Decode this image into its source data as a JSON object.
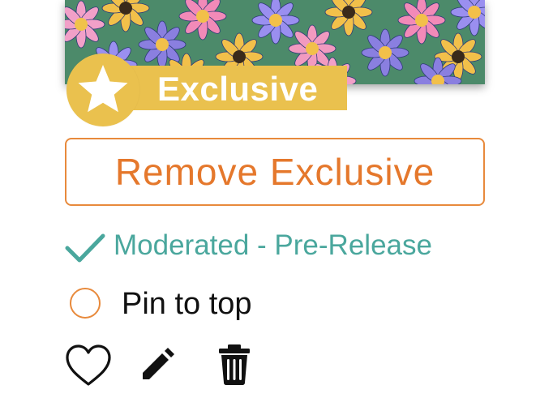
{
  "badge": {
    "label": "Exclusive",
    "icon": "star-icon",
    "color": "#eac14e"
  },
  "buttons": {
    "remove_exclusive": "Remove Exclusive"
  },
  "moderation": {
    "icon": "check-icon",
    "status": "Moderated - Pre-Release",
    "color": "#4aa79d"
  },
  "pin": {
    "label": "Pin to top",
    "checked": false
  },
  "actions": [
    {
      "name": "like",
      "icon": "heart-icon"
    },
    {
      "name": "edit",
      "icon": "pencil-icon"
    },
    {
      "name": "delete",
      "icon": "trash-icon"
    }
  ],
  "colors": {
    "accent_orange": "#e5782c",
    "teal": "#4aa79d",
    "badge_yellow": "#eac14e"
  }
}
